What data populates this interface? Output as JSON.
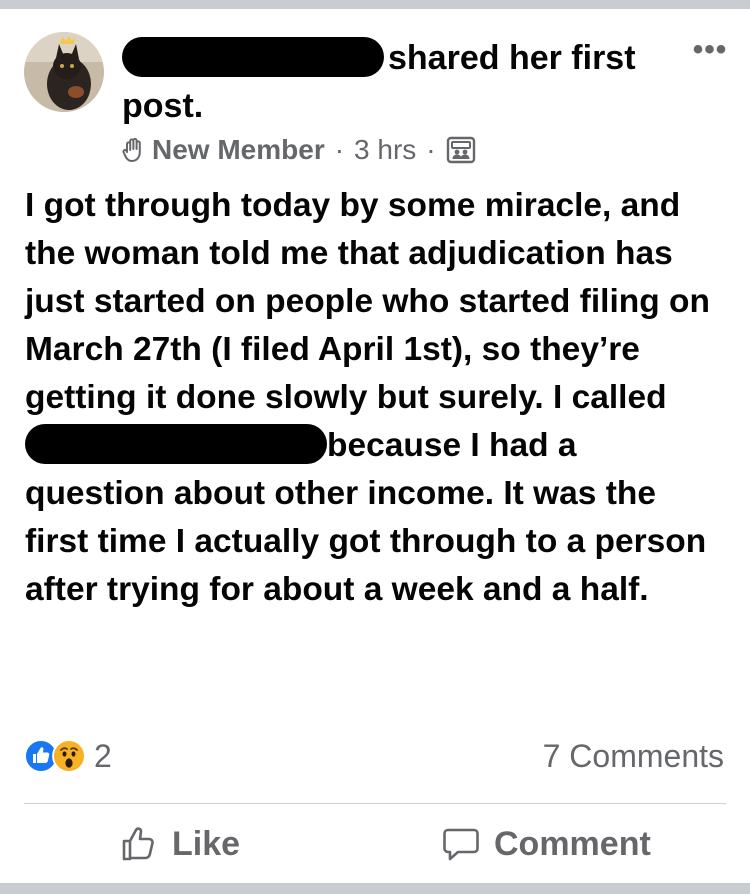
{
  "post": {
    "author_suffix": "shared her first post.",
    "badge": "New Member",
    "separator": "·",
    "time": "3 hrs",
    "more": "•••",
    "body_before_phone": "I got through today by some miracle, and the woman told me that adjudication has just started on people who started filing on March 27th (I filed April 1st), so they’re getting it done slowly but surely. I called ",
    "body_after_phone": "because I had a question about other income. It was the first time I actually got through to a person after trying for about a week and a half."
  },
  "reactions": {
    "icons": [
      "like-icon",
      "wow-icon"
    ],
    "count": "2",
    "comments": "7 Comments"
  },
  "actions": {
    "like": "Like",
    "comment": "Comment"
  },
  "colors": {
    "band": "#c9ccd1",
    "secondary_text": "#65676b",
    "like_blue": "#1877f2",
    "wow_yellow": "#f7b125"
  }
}
